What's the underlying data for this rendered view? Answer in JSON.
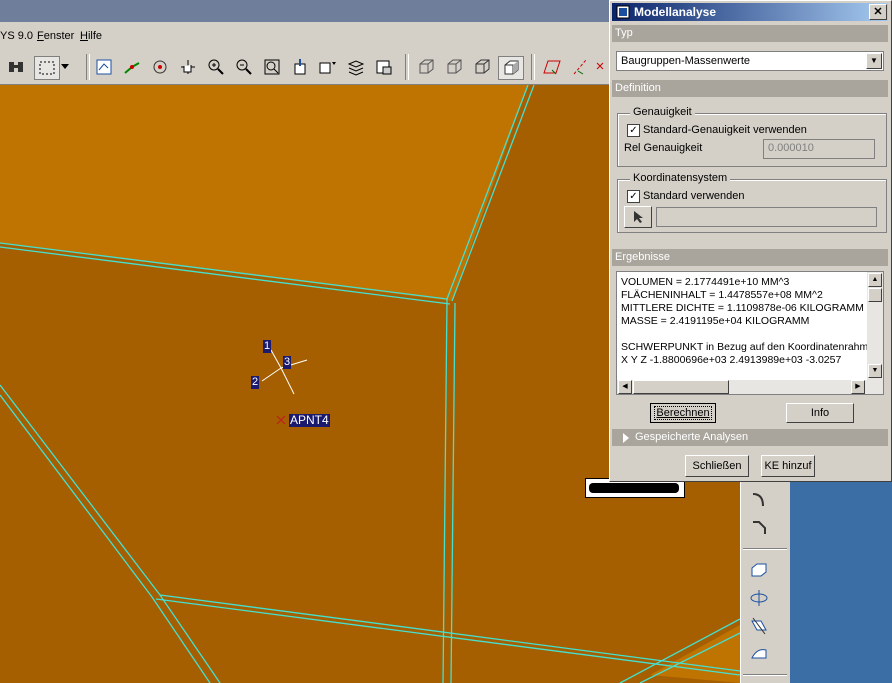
{
  "app": {
    "title_fragment": "YS 9.0",
    "menus": [
      {
        "label": "Fenster"
      },
      {
        "label": "Hilfe"
      }
    ]
  },
  "toolbar": {
    "icons": [
      "binoculars-icon",
      "box-select-icon",
      "dropdown-arrow-icon",
      "repaint-icon",
      "spin-center-icon",
      "orient-icon",
      "pan-icon",
      "zoom-in-icon",
      "zoom-out-icon",
      "refit-icon",
      "view-list-icon",
      "saved-views-icon",
      "layers-icon",
      "model-tree-icon",
      "wireframe-icon",
      "hidden-line-icon",
      "no-hidden-icon",
      "shading-icon",
      "datum-plane-icon",
      "datum-axis-icon",
      "datum-close-icon"
    ]
  },
  "viewport": {
    "datum_labels": [
      "1",
      "2",
      "3"
    ],
    "point_label": "APNT4",
    "colors": {
      "face_dark": "#a55f00",
      "face_light": "#bf7300",
      "edge": "#45e0d0"
    }
  },
  "side_toolbar": {
    "icons": [
      "round-icon",
      "chamfer-icon",
      "shell-icon",
      "pattern-icon",
      "draft-icon",
      "surface-icon"
    ]
  },
  "dialog": {
    "title": "Modellanalyse",
    "close_glyph": "✕",
    "type_section": "Typ",
    "type_value": "Baugruppen-Massenwerte",
    "definition_section": "Definition",
    "accuracy_group": "Genauigkeit",
    "accuracy_checkbox": "Standard-Genauigkeit verwenden",
    "rel_accuracy_label": "Rel Genauigkeit",
    "rel_accuracy_value": "0.000010",
    "coord_group": "Koordinatensystem",
    "coord_checkbox": "Standard verwenden",
    "results_section": "Ergebnisse",
    "results_lines": [
      "VOLUMEN =  2.1774491e+10  MM^3",
      "FLÄCHENINHALT =  1.4478557e+08  MM^2",
      "MITTLERE DICHTE =  1.1109878e-06 KILOGRAMM",
      "MASSE =  2.4191195e+04 KILOGRAMM",
      "",
      "SCHWERPUNKT in Bezug auf den Koordinatenrahmen",
      "X   Y   Z -1.8800696e+03  2.4913989e+03 -3.0257"
    ],
    "compute_button": "Berechnen",
    "info_button": "Info",
    "saved_analyses": "Gespeicherte Analysen",
    "close_button": "Schließen",
    "add_feature_button": "KE hinzuf"
  }
}
